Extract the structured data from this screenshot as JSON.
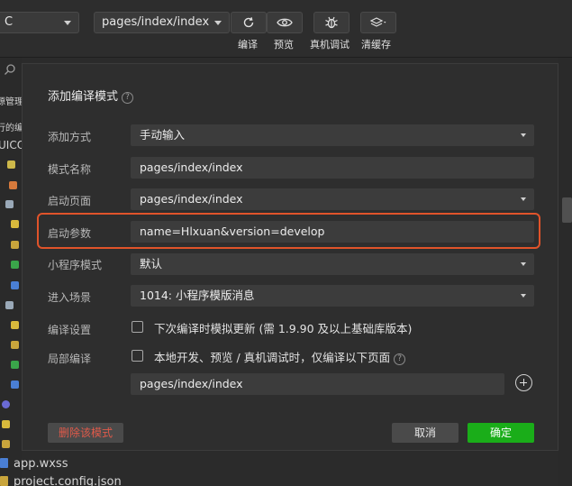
{
  "toolbar": {
    "left_select_value": "C",
    "page_select_value": "pages/index/index",
    "actions": [
      {
        "label": "编译",
        "icon": "refresh-icon"
      },
      {
        "label": "预览",
        "icon": "eye-icon"
      },
      {
        "label": "真机调试",
        "icon": "bug-icon"
      },
      {
        "label": "清缓存",
        "icon": "layers-icon"
      }
    ]
  },
  "left_tree": {
    "rows": [
      "源管理",
      "行的编",
      "UICO"
    ]
  },
  "bottom_files": [
    "app.wxss",
    "project.config.json"
  ],
  "dialog": {
    "title": "添加编译模式",
    "add_method": {
      "label": "添加方式",
      "value": "手动输入"
    },
    "mode_name": {
      "label": "模式名称",
      "value": "pages/index/index"
    },
    "start_page": {
      "label": "启动页面",
      "value": "pages/index/index"
    },
    "start_params": {
      "label": "启动参数",
      "value": "name=Hlxuan&version=develop"
    },
    "mini_mode": {
      "label": "小程序模式",
      "value": "默认"
    },
    "scene": {
      "label": "进入场景",
      "value": "1014: 小程序模版消息"
    },
    "compile_settings": {
      "label": "编译设置",
      "checkbox_text": "下次编译时模拟更新 (需 1.9.90 及以上基础库版本)",
      "checked": false
    },
    "partial_compile": {
      "label": "局部编译",
      "checkbox_text": "本地开发、预览 / 真机调试时，仅编译以下页面",
      "checked": false,
      "page_value": "pages/index/index"
    },
    "delete_label": "删除该模式",
    "cancel_label": "取消",
    "ok_label": "确定"
  },
  "colors": {
    "highlight": "#e0532a",
    "ok_button": "#1aad19",
    "danger_text": "#e05a4a"
  }
}
